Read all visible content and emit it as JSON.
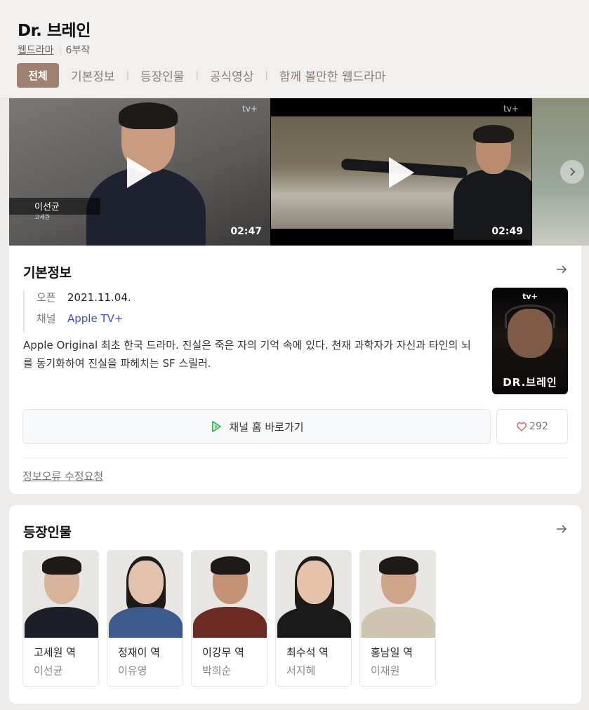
{
  "header": {
    "title": "Dr. 브레인",
    "genre": "웹드라마",
    "episodes": "6부작",
    "tabs": [
      {
        "label": "전체",
        "active": true
      },
      {
        "label": "기본정보"
      },
      {
        "label": "등장인물"
      },
      {
        "label": "공식영상"
      },
      {
        "label": "함께 볼만한 웹드라마"
      }
    ]
  },
  "videos": [
    {
      "duration": "02:47",
      "caption_name": "이선균",
      "caption_sub": "고세원",
      "watermark": "tv+"
    },
    {
      "duration": "02:49",
      "watermark": "tv+"
    }
  ],
  "basic_info": {
    "section_title": "기본정보",
    "open_key": "오픈",
    "open_value": "2021.11.04.",
    "channel_key": "채널",
    "channel_value": "Apple TV+",
    "description": "Apple Original 최초 한국 드라마. 진실은 죽은 자의 기억 속에 있다. 천재 과학자가 자신과 타인의 뇌를 동기화하여 진실을 파헤치는 SF 스릴러.",
    "poster_logo": "tv+",
    "poster_title": "DR.브레인",
    "channel_button": "채널 홈 바로가기",
    "like_count": "292",
    "report_link": "정보오류 수정요청"
  },
  "cast": {
    "section_title": "등장인물",
    "members": [
      {
        "role": "고세원 역",
        "actor": "이선균"
      },
      {
        "role": "정재이 역",
        "actor": "이유영"
      },
      {
        "role": "이강무 역",
        "actor": "박희순"
      },
      {
        "role": "최수석 역",
        "actor": "서지혜"
      },
      {
        "role": "홍남일 역",
        "actor": "이재원"
      }
    ]
  },
  "colors": {
    "active_tab_bg": "#a08070",
    "link_blue": "#3a53b8",
    "heart": "#e05a5a",
    "play_green": "#3cb55a"
  },
  "icons": {
    "play": "play-icon",
    "next": "chevron-right-icon",
    "arrow": "arrow-right-icon",
    "channel": "play-outline-icon",
    "heart": "heart-icon"
  }
}
